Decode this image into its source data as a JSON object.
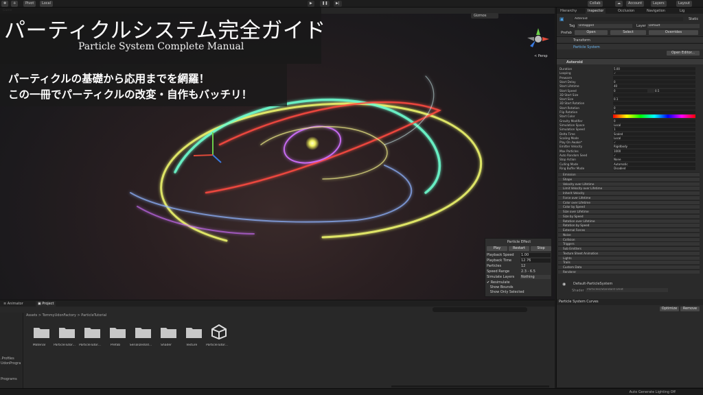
{
  "toolbar": {
    "pivot": "Pivot",
    "local": "Local",
    "collab": "Collab",
    "account": "Account",
    "layers": "Layers",
    "layout": "Layout"
  },
  "scene": {
    "tab": "Game",
    "gizmos": "Gizmos",
    "persp": "< Persp"
  },
  "banner": {
    "title_jp": "パーティクルシステム完全ガイド",
    "title_en": "Particle System Complete Manual",
    "line1": "パーティクルの基礎から応用までを網羅！",
    "line2": "この一冊でパーティクルの改変・自作もバッチリ！"
  },
  "particle_effect": {
    "title": "Particle Effect",
    "play": "Play",
    "restart": "Restart",
    "stop": "Stop",
    "rows": [
      {
        "label": "Playback Speed",
        "value": "1.00"
      },
      {
        "label": "Playback Time",
        "value": "12.76"
      },
      {
        "label": "Particles",
        "value": "12"
      },
      {
        "label": "Speed Range",
        "value": "2.3 - 6.5"
      },
      {
        "label": "Simulate Layers",
        "value": "Nothing"
      }
    ],
    "checks": [
      "Resimulate",
      "Show Bounds",
      "Show Only Selected"
    ]
  },
  "project": {
    "tab_animator": "Animator",
    "tab_project": "Project",
    "breadcrumb": "Assets > TommyUdonFactory > ParticleTutorial",
    "left_items": [
      ".Profiles",
      "UdonProgra",
      "Programs"
    ],
    "folders": [
      "Material",
      "ParticleTutor...",
      "ParticleTutor...",
      "Prefab",
      "SerializedUd...",
      "Shader",
      "Texture",
      "ParticleTutor..."
    ]
  },
  "inspector": {
    "tabs": [
      "Hierarchy",
      "Inspector",
      "Occlusion",
      "Navigation",
      "Lig"
    ],
    "object_name": "Asteroid",
    "static": "Static",
    "tag_label": "Tag",
    "tag_value": "Untagged",
    "layer_label": "Layer",
    "layer_value": "Default",
    "prefab_label": "Prefab",
    "prefab_open": "Open",
    "prefab_select": "Select",
    "prefab_overrides": "Overrides",
    "transform": "Transform",
    "particle_system": "Particle System",
    "open_editor": "Open Editor...",
    "module_name": "Asteroid",
    "properties": [
      {
        "label": "Duration",
        "value": "5.00"
      },
      {
        "label": "Looping",
        "value": "✓"
      },
      {
        "label": "Prewarm",
        "value": ""
      },
      {
        "label": "Start Delay",
        "value": "0"
      },
      {
        "label": "Start Lifetime",
        "value": "40"
      },
      {
        "label": "Start Speed",
        "value": "0"
      },
      {
        "label": "3D Start Size",
        "value": ""
      },
      {
        "label": "Start Size",
        "value": "0.1"
      },
      {
        "label": "3D Start Rotation",
        "value": ""
      },
      {
        "label": "Start Rotation",
        "value": "0"
      },
      {
        "label": "Flip Rotation",
        "value": "0"
      },
      {
        "label": "Start Color",
        "value": ""
      },
      {
        "label": "Gravity Modifier",
        "value": "0"
      },
      {
        "label": "Simulation Space",
        "value": "Local"
      },
      {
        "label": "Simulation Speed",
        "value": "1"
      },
      {
        "label": "Delta Time",
        "value": "Scaled"
      },
      {
        "label": "Scaling Mode",
        "value": "Local"
      },
      {
        "label": "Play On Awake*",
        "value": "✓"
      },
      {
        "label": "Emitter Velocity",
        "value": "Rigidbody"
      },
      {
        "label": "Max Particles",
        "value": "1000"
      },
      {
        "label": "Auto Random Seed",
        "value": "✓"
      },
      {
        "label": "Stop Action",
        "value": "None"
      },
      {
        "label": "Culling Mode",
        "value": "Automatic"
      },
      {
        "label": "Ring Buffer Mode",
        "value": "Disabled"
      }
    ],
    "start_speed_extra": "0.5",
    "modules": [
      "Emission",
      "Shape",
      "Velocity over Lifetime",
      "Limit Velocity over Lifetime",
      "Inherit Velocity",
      "Force over Lifetime",
      "Color over Lifetime",
      "Color by Speed",
      "Size over Lifetime",
      "Size by Speed",
      "Rotation over Lifetime",
      "Rotation by Speed",
      "External Forces",
      "Noise",
      "Collision",
      "Triggers",
      "Sub Emitters",
      "Texture Sheet Animation",
      "Lights",
      "Trails",
      "Custom Data",
      "Renderer"
    ],
    "material_name": "Default-ParticleSystem",
    "shader_label": "Shader",
    "shader_value": "Particles/Standard Unlit",
    "curves_title": "Particle System Curves",
    "optimize": "Optimize",
    "remove": "Remove"
  },
  "status": {
    "text": "Auto Generate Lighting Off"
  },
  "colors": {
    "accent": "#4aa0e6",
    "ring_yellow": "#e8f06a",
    "ring_green": "#6dffd0",
    "ring_red": "#ff4a40",
    "ring_blue": "#8fb4ff",
    "ring_purple": "#d070ff"
  }
}
